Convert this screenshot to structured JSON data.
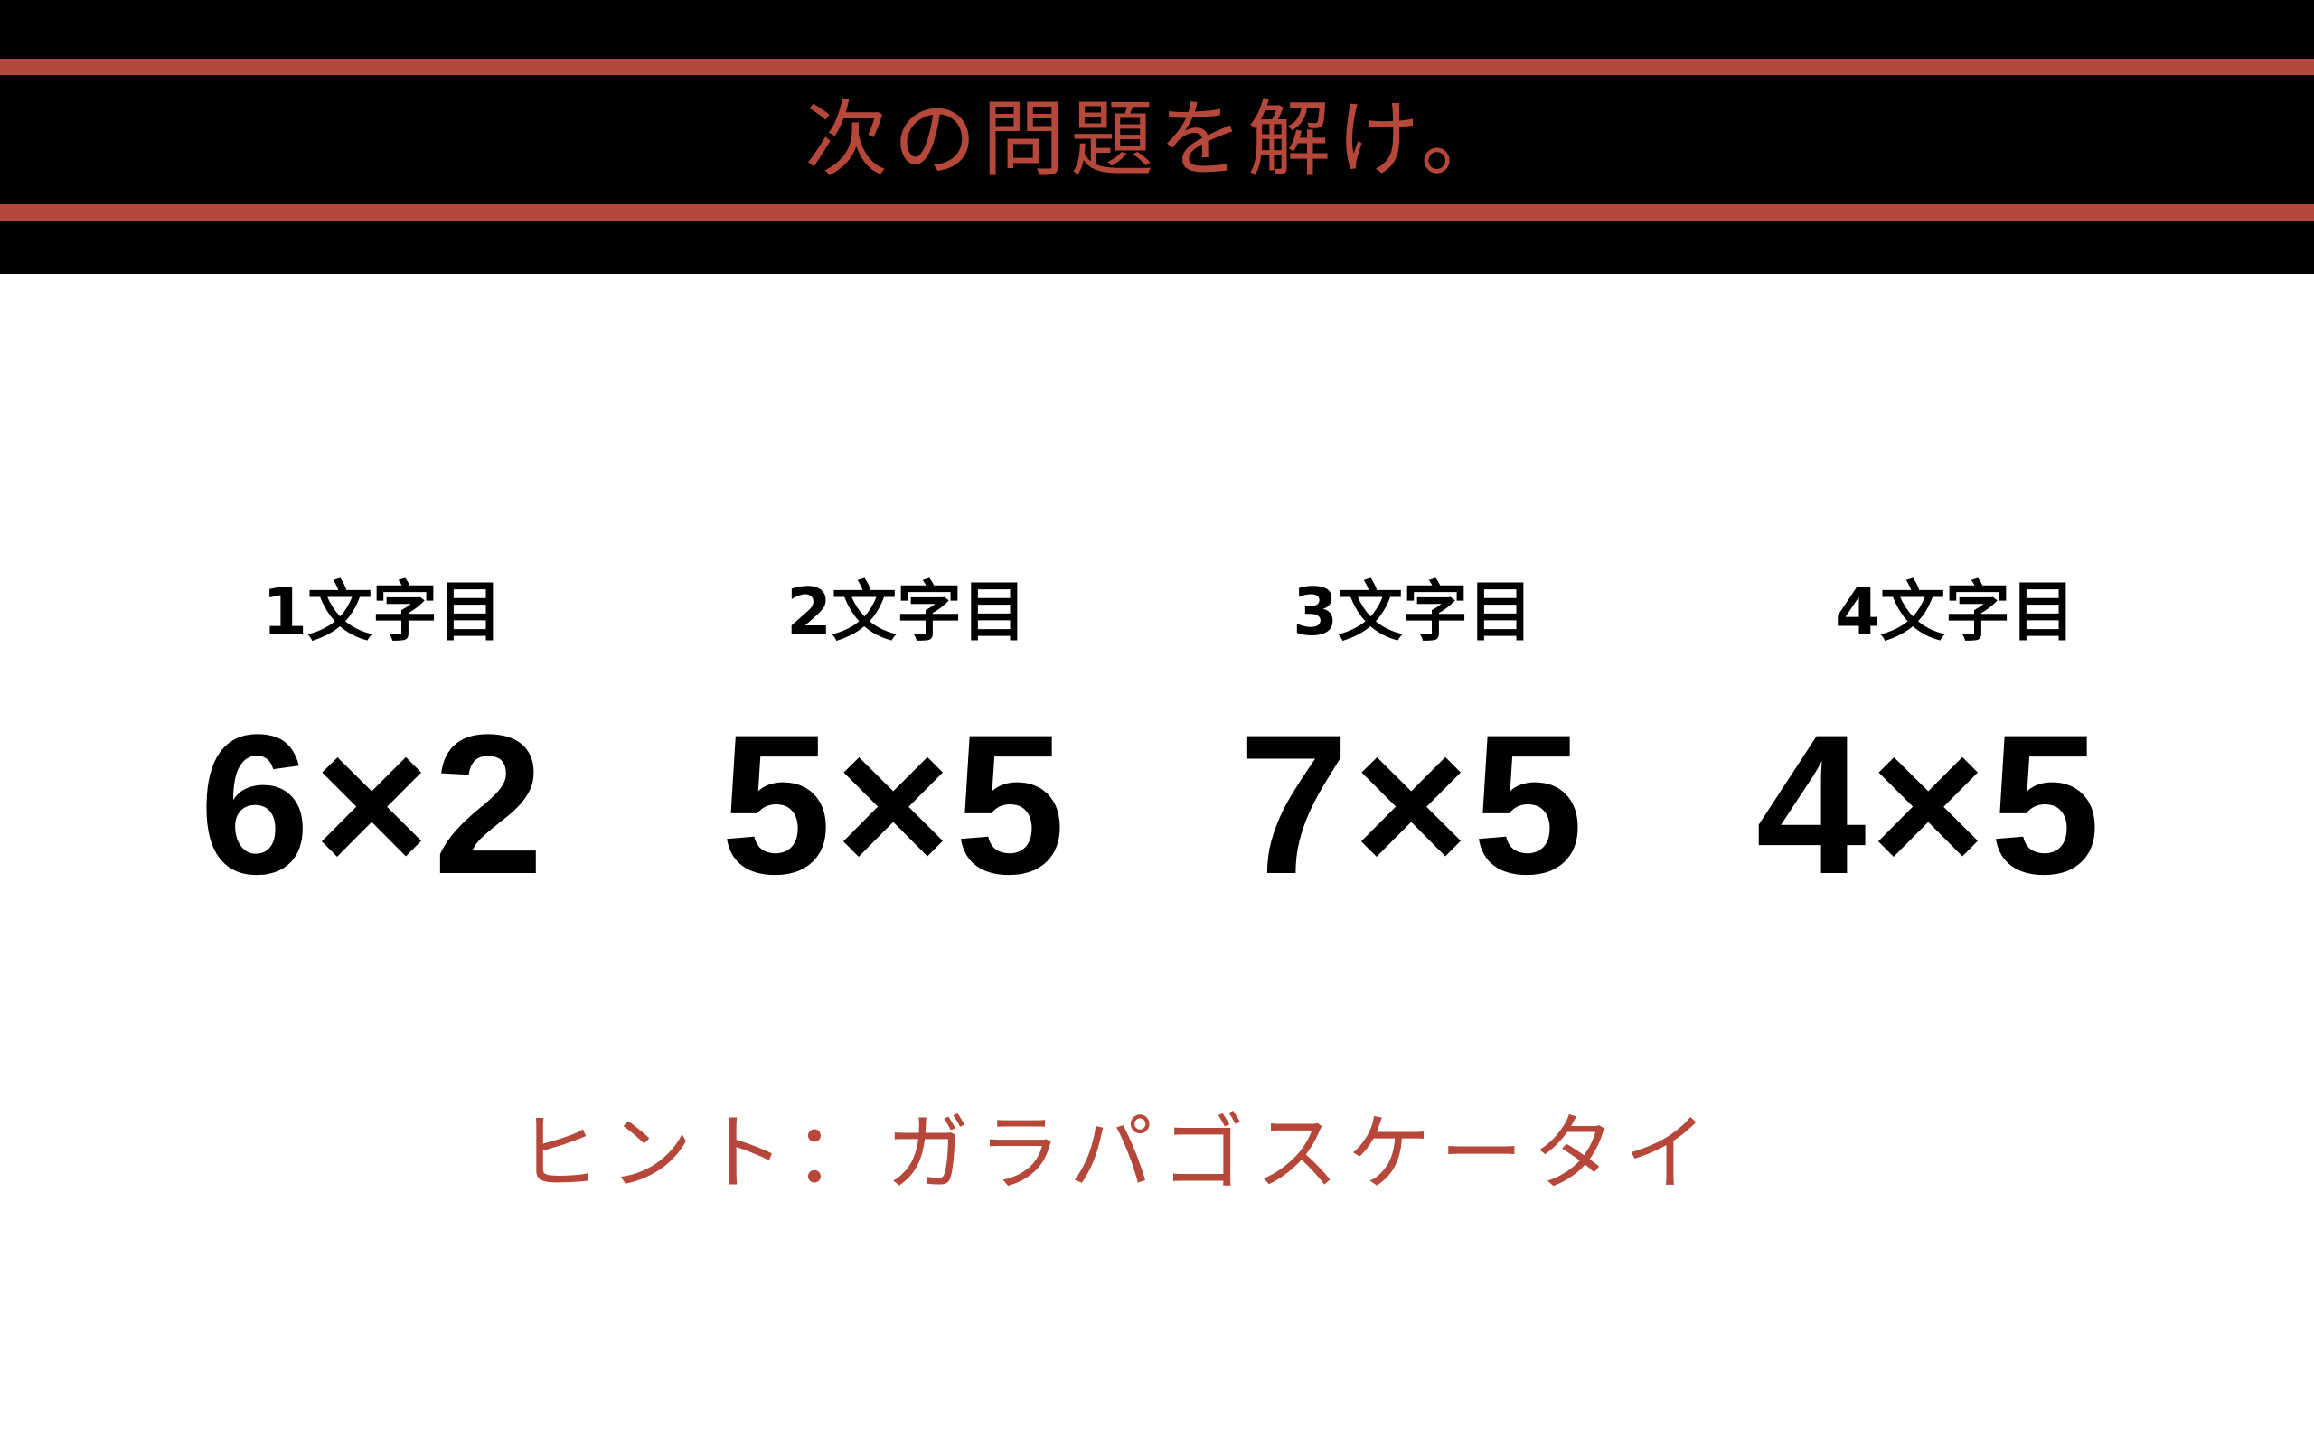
{
  "header": {
    "title": "次の問題を解け。"
  },
  "problems": [
    {
      "label": "1文字目",
      "expression": "6×2"
    },
    {
      "label": "2文字目",
      "expression": "5×5"
    },
    {
      "label": "3文字目",
      "expression": "7×5"
    },
    {
      "label": "4文字目",
      "expression": "4×5"
    }
  ],
  "hint": {
    "text": "ヒント：ガラパゴスケータイ"
  },
  "colors": {
    "accent": "#b5483a",
    "header_background": "#000000",
    "page_background": "#ffffff",
    "text": "#000000"
  }
}
